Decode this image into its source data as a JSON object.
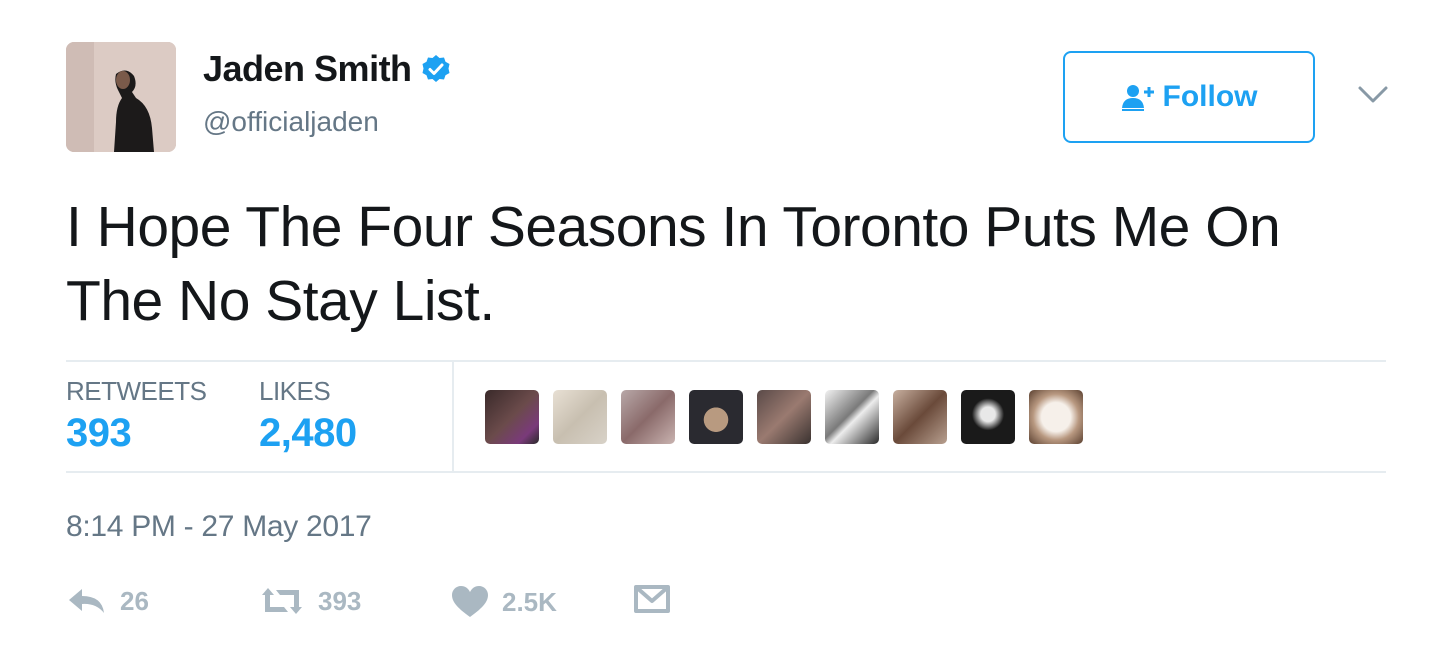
{
  "user": {
    "display_name": "Jaden Smith",
    "handle": "@officialjaden",
    "verified": true,
    "avatar_icon": "profile-photo"
  },
  "follow_button": {
    "label": "Follow",
    "icon": "add-user-icon"
  },
  "menu": {
    "icon": "chevron-down-icon"
  },
  "tweet": {
    "text": "I Hope The Four Seasons In Toronto Puts Me On The No Stay List."
  },
  "stats": {
    "retweets_label": "RETWEETS",
    "retweets_value": "393",
    "likes_label": "LIKES",
    "likes_value": "2,480"
  },
  "likers": [
    {
      "name": "liker-avatar-1"
    },
    {
      "name": "liker-avatar-2"
    },
    {
      "name": "liker-avatar-3"
    },
    {
      "name": "liker-avatar-4"
    },
    {
      "name": "liker-avatar-5"
    },
    {
      "name": "liker-avatar-6"
    },
    {
      "name": "liker-avatar-7"
    },
    {
      "name": "liker-avatar-8"
    },
    {
      "name": "liker-avatar-9"
    }
  ],
  "timestamp": "8:14 PM - 27 May 2017",
  "actions": {
    "reply_count": "26",
    "retweet_count": "393",
    "like_count": "2.5K",
    "message_icon": "envelope-icon"
  },
  "colors": {
    "accent": "#1da1f2",
    "text": "#14171a",
    "secondary": "#657786",
    "action": "#aab8c2",
    "divider": "#e6ecf0"
  }
}
